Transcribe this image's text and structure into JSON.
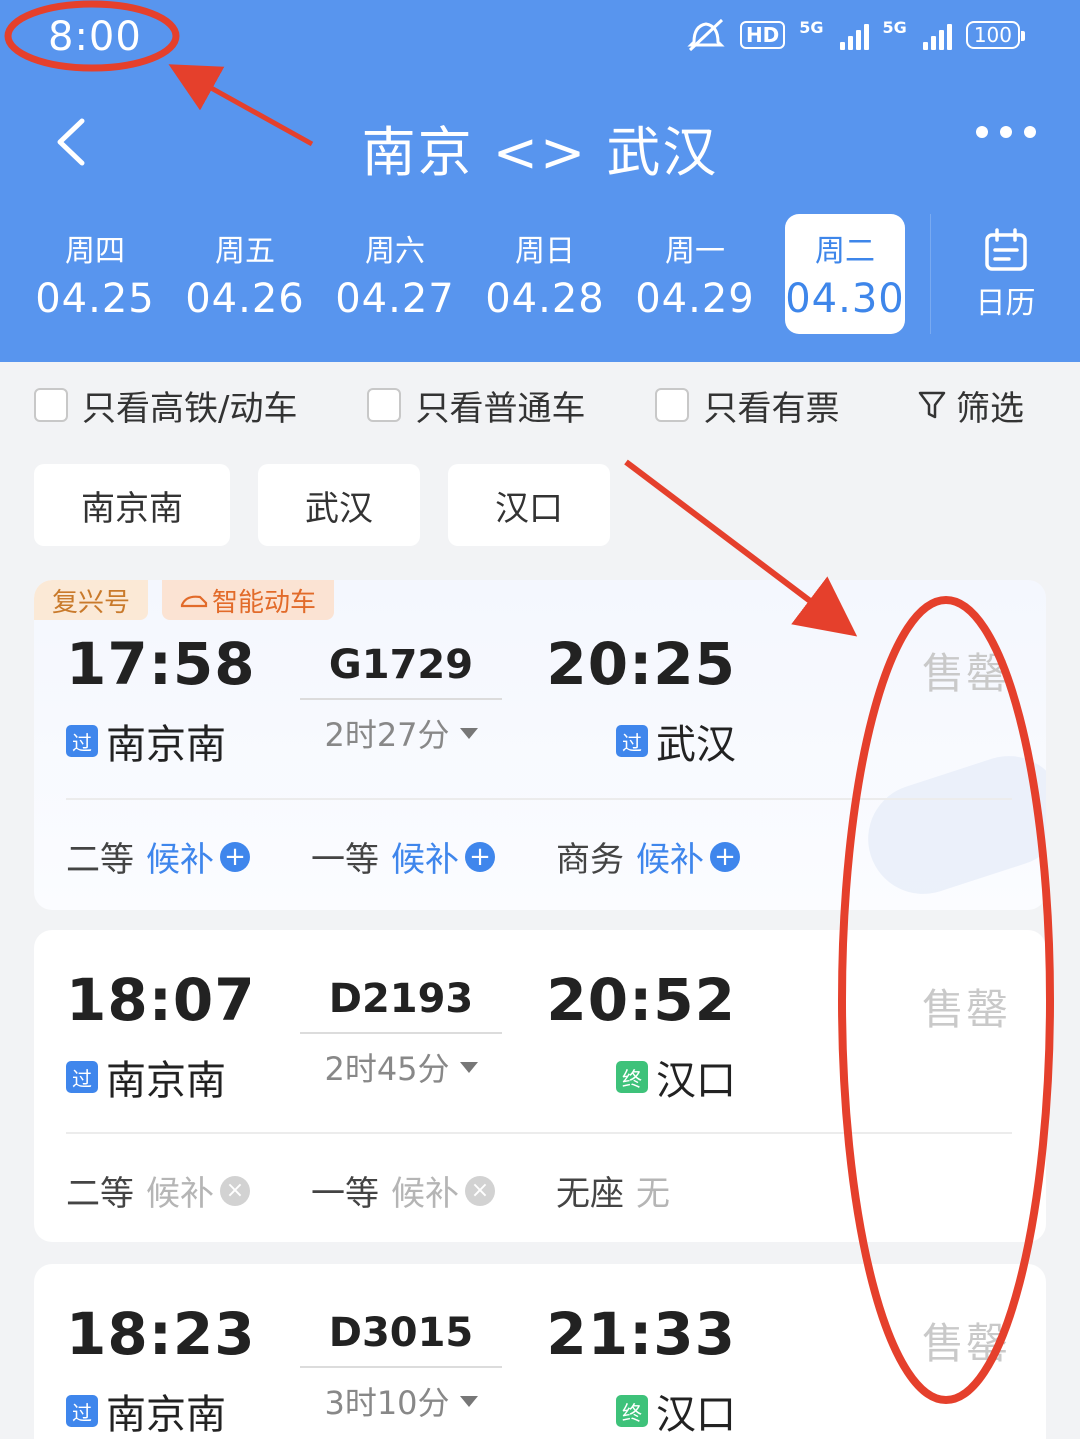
{
  "status_bar": {
    "time": "8:00",
    "hd": "HD",
    "network_1": "5G",
    "network_2": "5G",
    "battery": "100"
  },
  "header": {
    "title": "南京 <> 武汉",
    "dates": [
      {
        "weekday": "周四",
        "date": "04.25"
      },
      {
        "weekday": "周五",
        "date": "04.26"
      },
      {
        "weekday": "周六",
        "date": "04.27"
      },
      {
        "weekday": "周日",
        "date": "04.28"
      },
      {
        "weekday": "周一",
        "date": "04.29"
      },
      {
        "weekday": "周二",
        "date": "04.30",
        "selected": true
      }
    ],
    "calendar_label": "日历"
  },
  "filters": {
    "high_speed_only": "只看高铁/动车",
    "regular_only": "只看普通车",
    "available_only": "只看有票",
    "filter_label": "筛选"
  },
  "stations": [
    "南京南",
    "武汉",
    "汉口"
  ],
  "trains": [
    {
      "tags": [
        "复兴号",
        "智能动车"
      ],
      "dep_time": "17:58",
      "train_no": "G1729",
      "duration": "2时27分",
      "arr_time": "20:25",
      "dep_station": "南京南",
      "dep_badge": "过",
      "arr_station": "武汉",
      "arr_badge": "过",
      "status": "售罄",
      "seats": [
        {
          "class": "二等",
          "value": "候补"
        },
        {
          "class": "一等",
          "value": "候补"
        },
        {
          "class": "商务",
          "value": "候补"
        }
      ]
    },
    {
      "dep_time": "18:07",
      "train_no": "D2193",
      "duration": "2时45分",
      "arr_time": "20:52",
      "dep_station": "南京南",
      "dep_badge": "过",
      "arr_station": "汉口",
      "arr_badge": "终",
      "status": "售罄",
      "seats": [
        {
          "class": "二等",
          "value": "候补"
        },
        {
          "class": "一等",
          "value": "候补"
        },
        {
          "class": "无座",
          "value": "无"
        }
      ]
    },
    {
      "dep_time": "18:23",
      "train_no": "D3015",
      "duration": "3时10分",
      "arr_time": "21:33",
      "dep_station": "南京南",
      "dep_badge": "过",
      "arr_station": "汉口",
      "arr_badge": "终",
      "status": "售罄"
    }
  ],
  "colors": {
    "header_bg": "#5895ee",
    "accent_blue": "#3f86ec",
    "annotation_red": "#e5402c"
  }
}
